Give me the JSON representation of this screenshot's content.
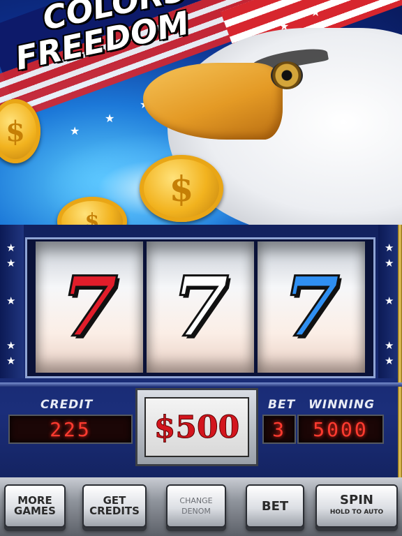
{
  "title": {
    "line1": "COLORS of",
    "line2": "FREEDOM"
  },
  "reels": [
    {
      "symbol": "7",
      "color": "#e11d2a"
    },
    {
      "symbol": "7",
      "color": "#ffffff"
    },
    {
      "symbol": "7",
      "color": "#2f8ff2"
    }
  ],
  "coin_symbol": "$",
  "labels": {
    "credit": "CREDIT",
    "bet": "BET",
    "winning": "WINNING"
  },
  "meters": {
    "credit": "225",
    "bet": "3",
    "winning": "5000"
  },
  "prize": "$500",
  "buttons": {
    "more_games": "MORE\nGAMES",
    "get_credits": "GET\nCREDITS",
    "change_denom": "CHANGE\nDENOM",
    "bet": "BET",
    "spin": "SPIN",
    "spin_sub": "HOLD TO AUTO"
  },
  "colors": {
    "led": "#ff3b30",
    "prize": "#d3151d",
    "panel": "#1b2e7a"
  }
}
